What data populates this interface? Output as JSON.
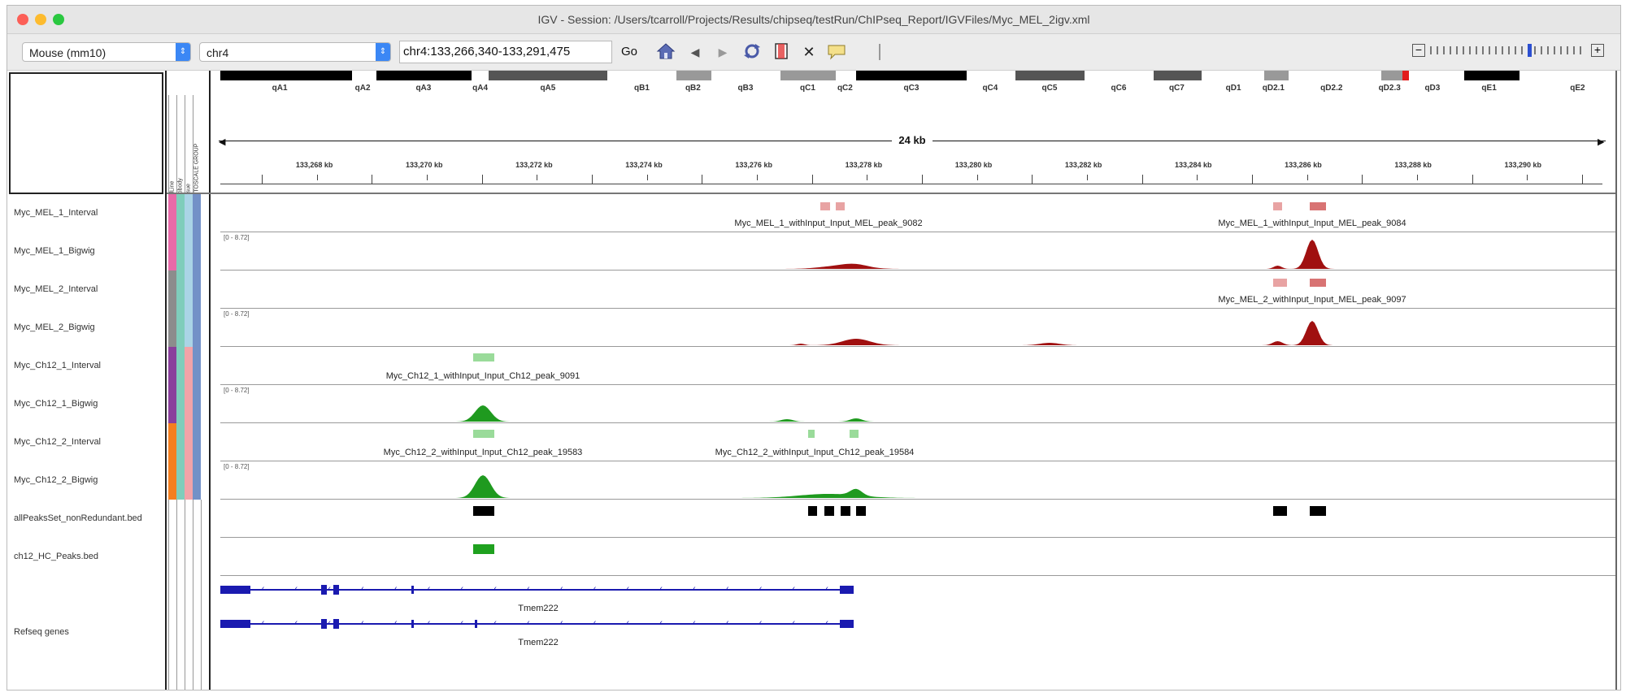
{
  "window": {
    "title": "IGV - Session: /Users/tcarroll/Projects/Results/chipseq/testRun/ChIPseq_Report/IGVFiles/Myc_MEL_2igv.xml"
  },
  "toolbar": {
    "genome": "Mouse (mm10)",
    "chromosome": "chr4",
    "locus": "chr4:133,266,340-133,291,475",
    "go_label": "Go"
  },
  "attribute_headers": [
    "cellLine",
    "Antibody",
    "Tissue",
    "AUTOSCALE GROUP"
  ],
  "ideogram": {
    "bands": [
      "qA1",
      "qA2",
      "qA3",
      "qA4",
      "qA5",
      "qB1",
      "qB2",
      "qB3",
      "qC1",
      "qC2",
      "qC3",
      "qC4",
      "qC5",
      "qC6",
      "qC7",
      "qD1",
      "qD2.1",
      "qD2.2",
      "qD2.3",
      "qD3",
      "qE1",
      "qE2"
    ]
  },
  "ruler": {
    "span_label": "24 kb",
    "ticks": [
      "133,268 kb",
      "133,270 kb",
      "133,272 kb",
      "133,274 kb",
      "133,276 kb",
      "133,278 kb",
      "133,280 kb",
      "133,282 kb",
      "133,284 kb",
      "133,286 kb",
      "133,288 kb",
      "133,290 kb"
    ]
  },
  "tracks": [
    {
      "name": "Myc_MEL_1_Interval",
      "attr_colors": [
        "#e86aa8",
        "#7fcdbb",
        "#aad4e6",
        "#7391c7"
      ]
    },
    {
      "name": "Myc_MEL_1_Bigwig",
      "attr_colors": [
        "#e86aa8",
        "#7fcdbb",
        "#aad4e6",
        "#7391c7"
      ],
      "scale": "[0 - 8.72]"
    },
    {
      "name": "Myc_MEL_2_Interval",
      "attr_colors": [
        "#8c8c8c",
        "#7fcdbb",
        "#aad4e6",
        "#7391c7"
      ]
    },
    {
      "name": "Myc_MEL_2_Bigwig",
      "attr_colors": [
        "#8c8c8c",
        "#7fcdbb",
        "#aad4e6",
        "#7391c7"
      ],
      "scale": "[0 - 8.72]"
    },
    {
      "name": "Myc_Ch12_1_Interval",
      "attr_colors": [
        "#8a3f9c",
        "#7fcdbb",
        "#f2a3a8",
        "#7391c7"
      ]
    },
    {
      "name": "Myc_Ch12_1_Bigwig",
      "attr_colors": [
        "#8a3f9c",
        "#7fcdbb",
        "#f2a3a8",
        "#7391c7"
      ],
      "scale": "[0 - 8.72]"
    },
    {
      "name": "Myc_Ch12_2_Interval",
      "attr_colors": [
        "#f47f1f",
        "#7fcdbb",
        "#f2a3a8",
        "#7391c7"
      ]
    },
    {
      "name": "Myc_Ch12_2_Bigwig",
      "attr_colors": [
        "#f47f1f",
        "#7fcdbb",
        "#f2a3a8",
        "#7391c7"
      ],
      "scale": "[0 - 8.72]"
    },
    {
      "name": "allPeaksSet_nonRedundant.bed"
    },
    {
      "name": "ch12_HC_Peaks.bed"
    },
    {
      "name": "Refseq genes"
    }
  ],
  "peak_labels": {
    "mel1_a": "Myc_MEL_1_withInput_Input_MEL_peak_9082",
    "mel1_b": "Myc_MEL_1_withInput_Input_MEL_peak_9084",
    "mel2_a": "Myc_MEL_2_withInput_Input_MEL_peak_9097",
    "ch12_1_a": "Myc_Ch12_1_withInput_Input_Ch12_peak_9091",
    "ch12_2_a": "Myc_Ch12_2_withInput_Input_Ch12_peak_19583",
    "ch12_2_b": "Myc_Ch12_2_withInput_Input_Ch12_peak_19584"
  },
  "gene_labels": {
    "gene1": "Tmem222",
    "gene2": "Tmem222"
  },
  "colors": {
    "mel_signal": "#a01010",
    "ch12_signal": "#1f9a1f",
    "mel_interval": "#e8a3a3",
    "ch12_interval": "#9adb9a",
    "bed_black": "#000000",
    "bed_green": "#1fa11f",
    "gene": "#1a1ab0",
    "cytoband_red": "#e21b1b"
  },
  "icons": [
    "home-icon",
    "back-icon",
    "forward-icon",
    "refresh-icon",
    "region-icon",
    "resize-icon",
    "popup-text-icon",
    "ruler-divider-icon",
    "zoom-out-icon",
    "zoom-in-icon"
  ]
}
